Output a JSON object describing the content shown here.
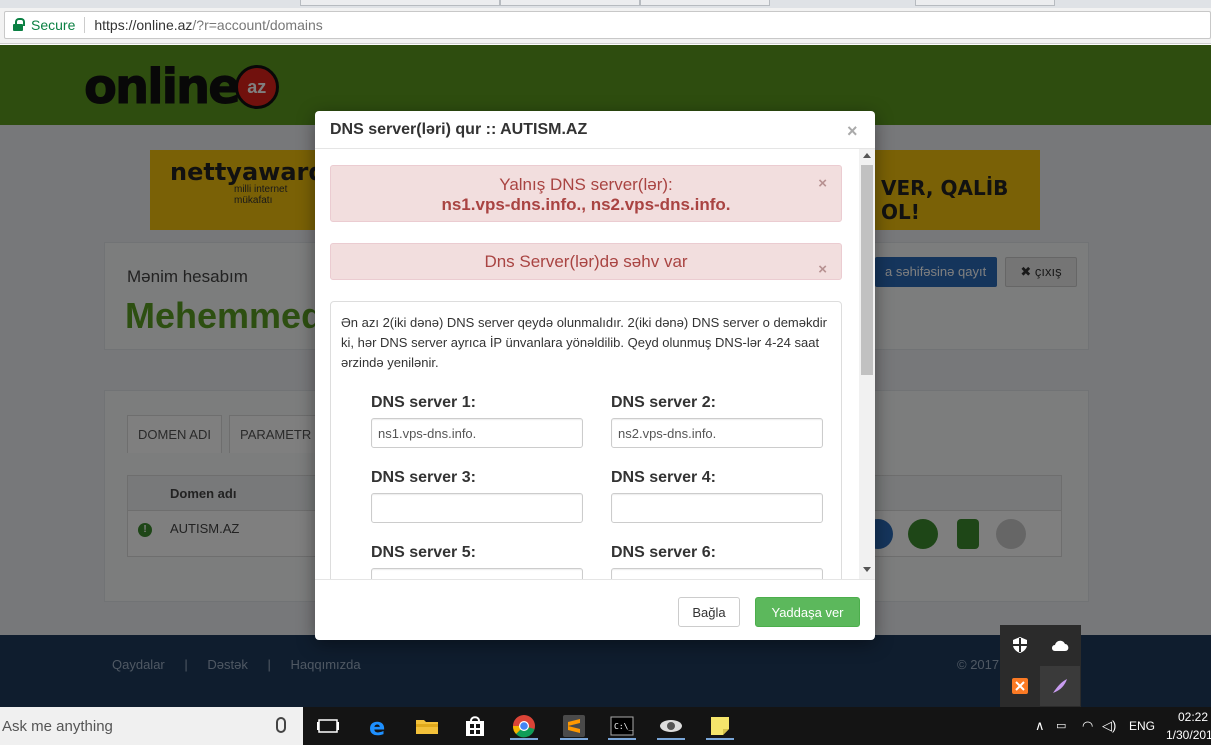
{
  "browser": {
    "secure_label": "Secure",
    "url_host": "https://online.az",
    "url_path": "/?r=account/domains"
  },
  "site": {
    "logo_text": "online",
    "logo_suffix": "az",
    "banner_left_title": "nettyaward",
    "banner_left_sub": "milli internet mükafatı",
    "banner_right_text": "VER, QALİB OL!",
    "account_label": "Mənim hesabım",
    "account_name": "Mehemmed",
    "back_button": "a səhifəsinə qayıt",
    "exit_button": "✖ çıxış",
    "tabs": [
      "DOMEN ADI",
      "PARAMETR"
    ],
    "table_header": "Domen adı",
    "domain_row": "AUTISM.AZ",
    "footer_links": [
      "Qaydalar",
      "|",
      "Dəstək",
      "|",
      "Haqqımızda"
    ],
    "footer_copy": "© 2017"
  },
  "modal": {
    "title": "DNS server(ləri) qur :: AUTISM.AZ",
    "close_glyph": "×",
    "alert1_line1": "Yalnış DNS server(lər):",
    "alert1_line2": "ns1.vps-dns.info., ns2.vps-dns.info.",
    "alert2_text": "Dns Server(lər)də səhv var",
    "info_text": "Ən azı 2(iki dənə) DNS server qeydə olunmalıdır. 2(iki dənə) DNS server o deməkdir ki, hər DNS server ayrıca İP ünvanlara yönəldilib. Qeyd olunmuş DNS-lər 4-24 saat ərzində yenilənir.",
    "fields": [
      {
        "label": "DNS server 1:",
        "value": "ns1.vps-dns.info."
      },
      {
        "label": "DNS server 2:",
        "value": "ns2.vps-dns.info."
      },
      {
        "label": "DNS server 3:",
        "value": ""
      },
      {
        "label": "DNS server 4:",
        "value": ""
      },
      {
        "label": "DNS server 5:",
        "value": ""
      },
      {
        "label": "DNS server 6:",
        "value": ""
      }
    ],
    "close_button": "Bağla",
    "save_button": "Yaddaşa ver"
  },
  "taskbar": {
    "search_placeholder": "Ask me anything",
    "language": "ENG",
    "time": "02:22",
    "date": "1/30/201"
  },
  "colors": {
    "header_green": "#5c9a1e",
    "alert_bg": "#f2dede",
    "alert_text": "#a94442",
    "save_green": "#5cb85c",
    "footer_navy": "#1e3a5c"
  }
}
